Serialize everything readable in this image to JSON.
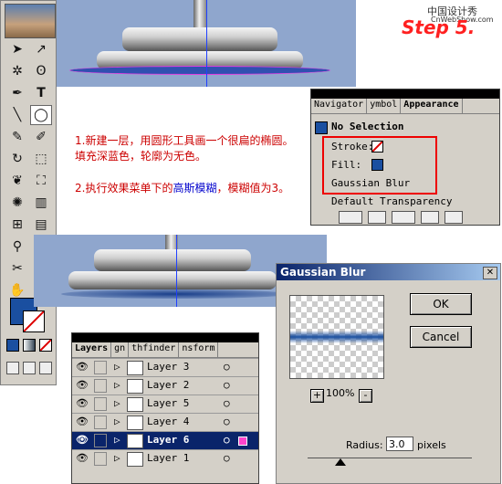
{
  "watermark": {
    "line1": "中国设计秀",
    "line2": "CnWebShow.com"
  },
  "step_label": "Step 5.",
  "toolbox": {
    "tools": [
      "selection-tool",
      "direct-selection-tool",
      "magic-wand-tool",
      "lasso-tool",
      "pen-tool",
      "type-tool",
      "line-tool",
      "ellipse-tool",
      "paintbrush-tool",
      "pencil-tool",
      "rotate-tool",
      "scale-tool",
      "warp-tool",
      "free-transform-tool",
      "symbol-sprayer-tool",
      "graph-tool",
      "mesh-tool",
      "gradient-tool",
      "eyedropper-tool",
      "blend-tool",
      "scissors-tool",
      "knife-tool",
      "hand-tool",
      "zoom-tool"
    ],
    "fill_color": "#1a4fa0"
  },
  "instructions": {
    "item1": "1.新建一层，用圆形工具画一个很扁的椭圆。填充深蓝色，轮廓为无色。",
    "item2_prefix": "2.执行效果菜单下的",
    "item2_highlight": "高斯模糊",
    "item2_suffix": "，模糊值为3。"
  },
  "navigator": {
    "tabs": [
      "Navigator",
      "ymbol",
      "Appearance"
    ],
    "selection": "No Selection",
    "stroke_label": "Stroke:",
    "fill_label": "Fill:",
    "effect": "Gaussian Blur",
    "transparency": "Default Transparency"
  },
  "gaussian_dialog": {
    "title": "Gaussian Blur",
    "ok_label": "OK",
    "cancel_label": "Cancel",
    "zoom": "100%",
    "zoom_in": "+",
    "zoom_out": "-",
    "radius_label": "Radius:",
    "radius_value": "3.0",
    "radius_unit": "pixels",
    "radius_slider": 0.2
  },
  "layers_panel": {
    "tabs": [
      "Layers",
      "gn",
      "thfinder",
      "nsform"
    ],
    "rows": [
      {
        "name": "Layer 3",
        "selected": false
      },
      {
        "name": "Layer 2",
        "selected": false
      },
      {
        "name": "Layer 5",
        "selected": false
      },
      {
        "name": "Layer 4",
        "selected": false
      },
      {
        "name": "Layer 6",
        "selected": true
      },
      {
        "name": "Layer 1",
        "selected": false
      }
    ]
  },
  "colors": {
    "accent_red": "#cc0000",
    "highlight_blue": "#0000cc",
    "canvas_blue": "#8fa6cd",
    "selection": "#0a246a"
  }
}
